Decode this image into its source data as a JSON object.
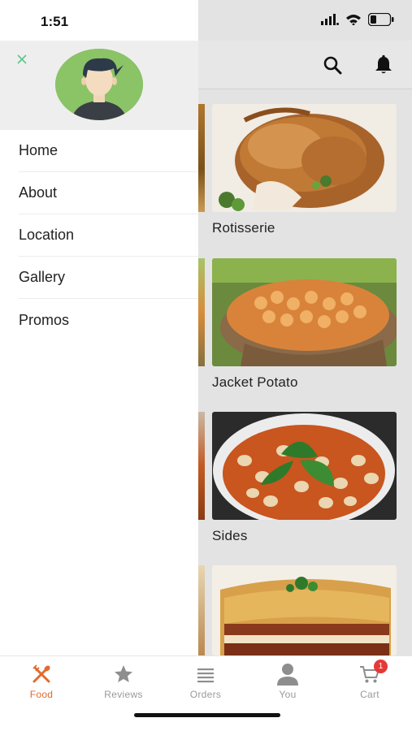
{
  "status_bar": {
    "time": "1:51"
  },
  "drawer": {
    "close_icon": "close-icon",
    "avatar_icon": "user-avatar",
    "menu": [
      {
        "label": "Home"
      },
      {
        "label": "About"
      },
      {
        "label": "Location"
      },
      {
        "label": "Gallery"
      },
      {
        "label": "Promos"
      }
    ]
  },
  "header": {
    "icons": [
      "search-icon",
      "bell-icon"
    ]
  },
  "categories": [
    {
      "label": "Rotisserie"
    },
    {
      "label": "Jacket Potato"
    },
    {
      "label": "Sides"
    },
    {
      "label": ""
    }
  ],
  "tab_bar": {
    "tabs": [
      {
        "label": "Food",
        "icon": "utensils-icon",
        "active": true
      },
      {
        "label": "Reviews",
        "icon": "star-icon"
      },
      {
        "label": "Orders",
        "icon": "list-icon"
      },
      {
        "label": "You",
        "icon": "person-icon"
      },
      {
        "label": "Cart",
        "icon": "cart-icon"
      }
    ],
    "cart_badge": "1"
  },
  "colors": {
    "accent": "#e06a2e",
    "avatar_bg": "#8bc367",
    "badge": "#e53935",
    "close_icon": "#5cc58a"
  }
}
